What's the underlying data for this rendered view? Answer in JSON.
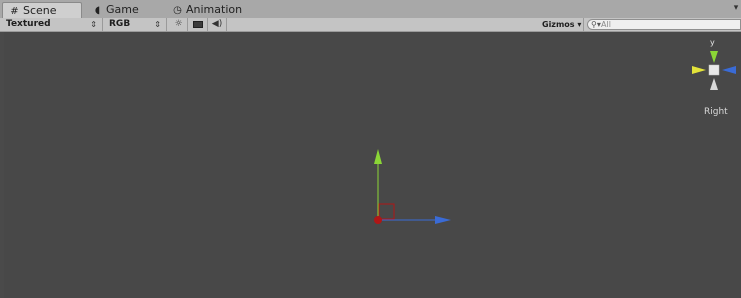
{
  "tabs": [
    {
      "label": "Scene",
      "icon": "scene-grid-icon",
      "active": true
    },
    {
      "label": "Game",
      "icon": "game-pacman-icon",
      "active": false
    },
    {
      "label": "Animation",
      "icon": "clock-icon",
      "active": false
    }
  ],
  "toolbar": {
    "render_mode": "Textured",
    "channels": "RGB",
    "gizmos_label": "Gizmos",
    "search_placeholder": "All"
  },
  "orientation_gizmo": {
    "view_label": "Right",
    "axis_label": "y"
  },
  "colors": {
    "viewport_bg": "#484848",
    "axis_x": "#3a6bd6",
    "axis_y": "#8bd636",
    "axis_z_origin": "#b01616"
  }
}
